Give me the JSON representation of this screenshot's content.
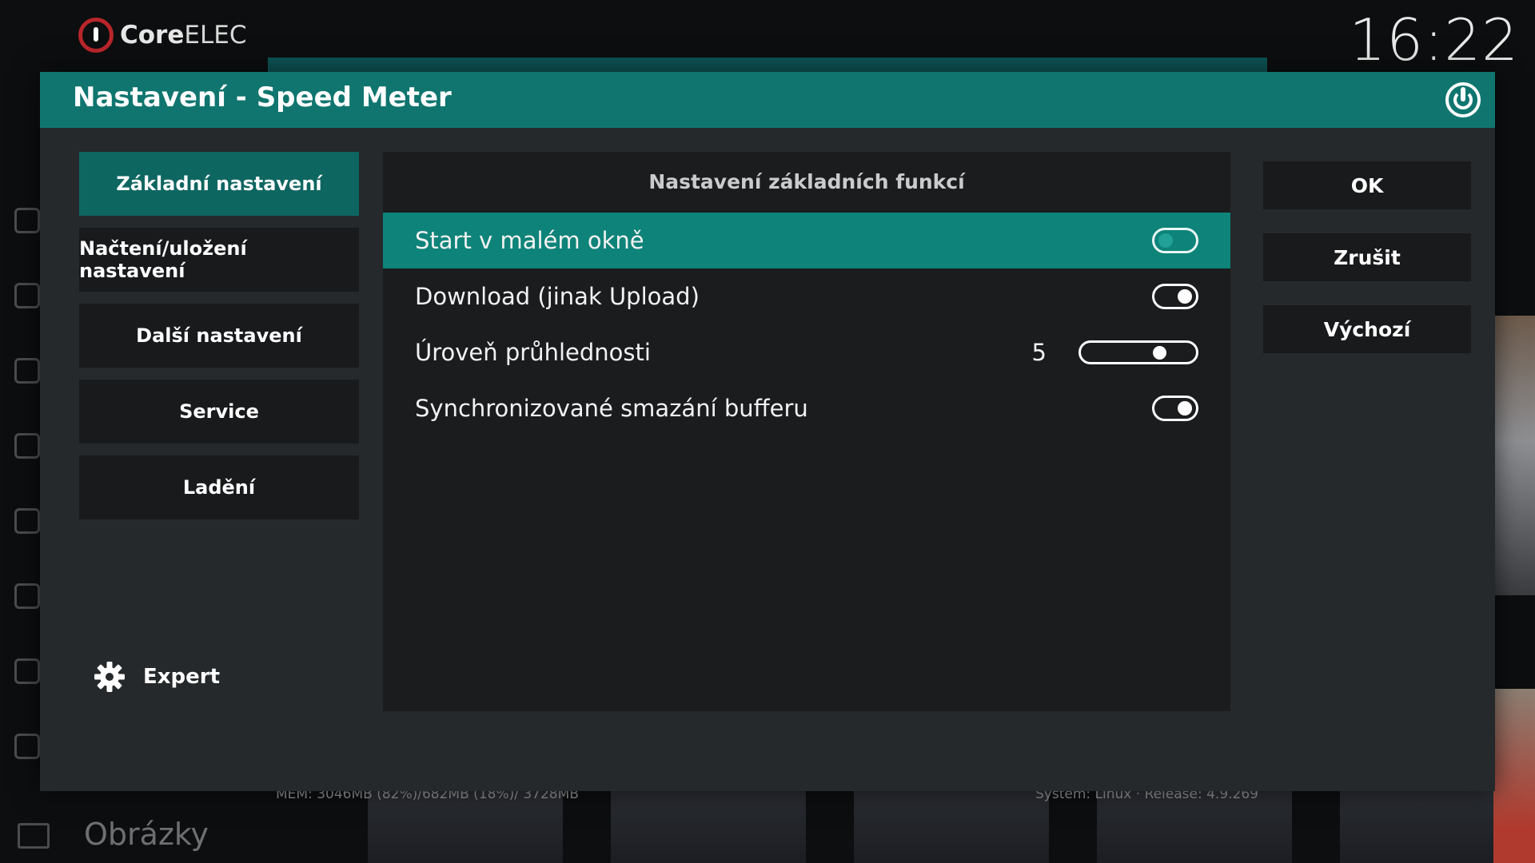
{
  "background": {
    "brand": {
      "prefix": "Core",
      "suffix": "ELEC"
    },
    "clock": "16:22",
    "menu_label": "Obrázky",
    "status_left": "MEM: 3046MB (82%)/682MB (18%)/ 3728MB",
    "status_right": "System: Linux · Release: 4.9.269"
  },
  "dialog": {
    "title": "Nastavení - Speed Meter",
    "header_icon": "power-icon",
    "categories": [
      {
        "label": "Základní nastavení",
        "active": true
      },
      {
        "label": "Načtení/uložení nastavení",
        "active": false
      },
      {
        "label": "Další nastavení",
        "active": false
      },
      {
        "label": "Service",
        "active": false
      },
      {
        "label": "Ladění",
        "active": false
      }
    ],
    "expert": {
      "icon": "gear-icon",
      "label": "Expert"
    },
    "panel": {
      "title": "Nastavení základních funkcí",
      "settings": [
        {
          "label": "Start v malém okně",
          "type": "toggle",
          "state": "off",
          "focused": true
        },
        {
          "label": "Download (jinak Upload)",
          "type": "toggle",
          "state": "on",
          "focused": false
        },
        {
          "label": "Úroveň průhlednosti",
          "type": "slider",
          "value": "5",
          "level": 0.72,
          "focused": false
        },
        {
          "label": "Synchronizované smazání bufferu",
          "type": "toggle",
          "state": "on",
          "focused": false
        }
      ]
    },
    "buttons": {
      "ok": "OK",
      "cancel": "Zrušit",
      "default": "Výchozí"
    }
  },
  "colors": {
    "accent": "#10756f",
    "focus_row": "#0e8379",
    "active_category": "#0e6661",
    "dialog_bg": "#25292b",
    "panel_bg": "#1a1c1e",
    "brand_red": "#b8262b"
  }
}
